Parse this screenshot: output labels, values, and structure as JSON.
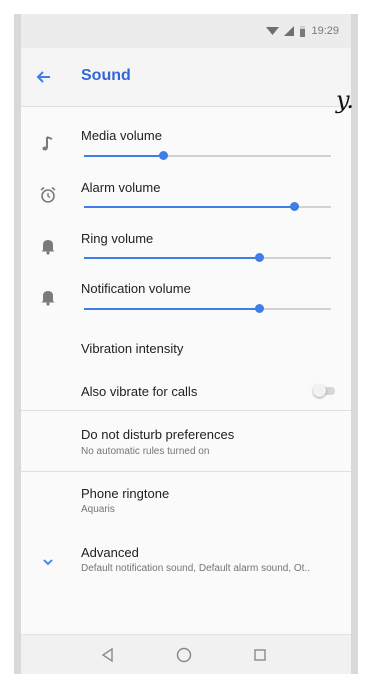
{
  "status_bar": {
    "time": "19:29"
  },
  "app_bar": {
    "title": "Sound"
  },
  "overlay": {
    "scribble_text": "y."
  },
  "volume_rows": [
    {
      "label": "Media volume",
      "level_pct": 32,
      "icon": "music-note-icon"
    },
    {
      "label": "Alarm volume",
      "level_pct": 85,
      "icon": "alarm-clock-icon"
    },
    {
      "label": "Ring volume",
      "level_pct": 71,
      "icon": "bell-icon"
    },
    {
      "label": "Notification volume",
      "level_pct": 71,
      "icon": "bell-icon"
    }
  ],
  "vibration": {
    "label": "Vibration intensity"
  },
  "vibrate_calls": {
    "label": "Also vibrate for calls",
    "enabled": false
  },
  "dnd": {
    "label": "Do not disturb preferences",
    "sub": "No automatic rules turned on"
  },
  "ringtone": {
    "label": "Phone ringtone",
    "sub": "Aquaris"
  },
  "advanced": {
    "label": "Advanced",
    "sub": "Default notification sound, Default alarm sound, Ot.."
  },
  "nav": {
    "icons": [
      "back-triangle-icon",
      "home-circle-icon",
      "recents-square-icon"
    ]
  },
  "colors": {
    "accent": "#3f7ee8",
    "title": "#3367d6",
    "icon": "#7a7a7a"
  }
}
